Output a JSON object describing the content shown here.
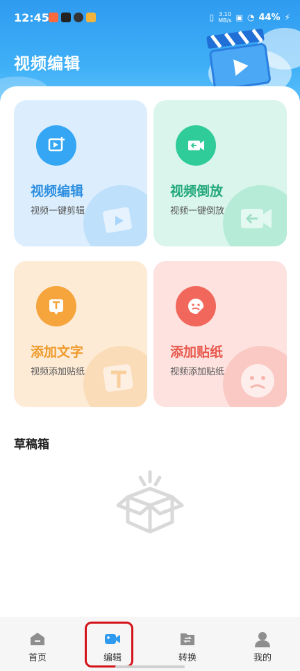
{
  "status_bar": {
    "time": "12:45",
    "net_speed": "3.10",
    "net_unit": "MB/s",
    "battery": "44%"
  },
  "header": {
    "title": "视频编辑"
  },
  "cards": [
    {
      "title": "视频编辑",
      "subtitle": "视频一键剪辑",
      "icon": "video-crop-icon",
      "title_color": "#2e8fe0",
      "bg": "#dceefd",
      "icon_bg": "#34a6f3"
    },
    {
      "title": "视频倒放",
      "subtitle": "视频一键倒放",
      "icon": "video-reverse-icon",
      "title_color": "#23a87a",
      "bg": "#d9f5ec",
      "icon_bg": "#2fcb98"
    },
    {
      "title": "添加文字",
      "subtitle": "视频添加贴纸",
      "icon": "text-t-icon",
      "title_color": "#ef9a2a",
      "bg": "#fdebd6",
      "icon_bg": "#f6a43c"
    },
    {
      "title": "添加贴纸",
      "subtitle": "视频添加贴纸",
      "icon": "sticker-face-icon",
      "title_color": "#e8584c",
      "bg": "#fde2df",
      "icon_bg": "#f2675b"
    }
  ],
  "drafts": {
    "title": "草稿箱",
    "empty_icon": "empty-box-icon"
  },
  "tabbar": {
    "items": [
      {
        "label": "首页",
        "icon": "home-icon"
      },
      {
        "label": "编辑",
        "icon": "video-camera-icon"
      },
      {
        "label": "转换",
        "icon": "convert-icon"
      },
      {
        "label": "我的",
        "icon": "profile-icon"
      }
    ],
    "active_index": 1
  },
  "colors": {
    "header_blue": "#3fb0f7",
    "active_tab": "#2f9bf0",
    "highlight_red": "#d4141b"
  }
}
